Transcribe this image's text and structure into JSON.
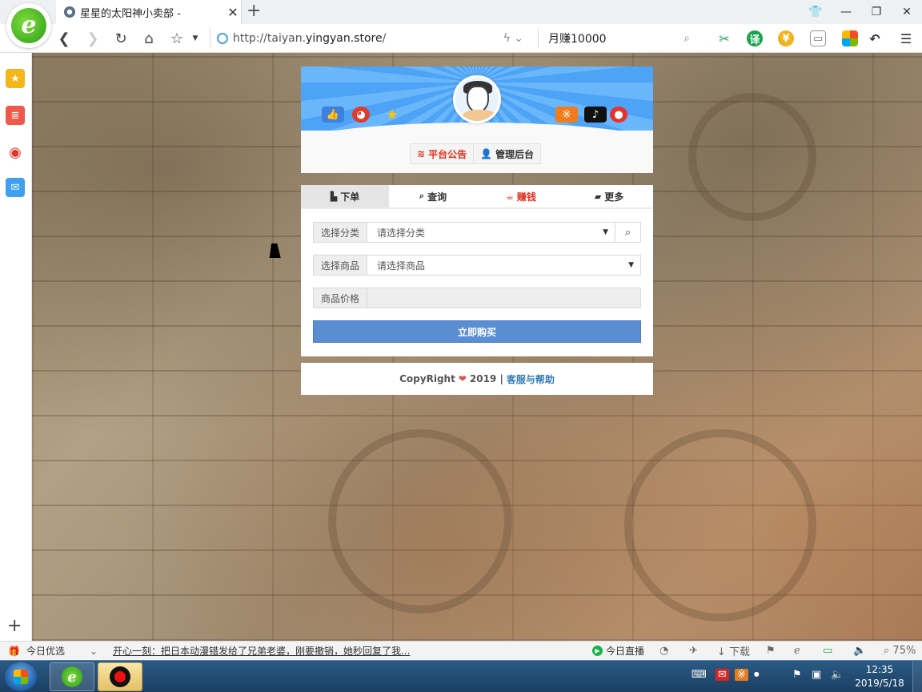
{
  "browser": {
    "tab_title": "星星的太阳神小卖部 -",
    "url_prefix": "http://taiyan.",
    "url_domain": "yingyan.store",
    "url_suffix": "/",
    "search_query": "月赚10000",
    "new_tab_symbol": "+",
    "tab_close_symbol": "✕"
  },
  "header": {
    "notice_button": "平台公告",
    "admin_button": "管理后台"
  },
  "tabs": [
    {
      "label": "下单",
      "icon": "shopping-bag-icon"
    },
    {
      "label": "查询",
      "icon": "search-icon"
    },
    {
      "label": "赚钱",
      "icon": "coffee-cup-icon"
    },
    {
      "label": "更多",
      "icon": "folder-open-icon"
    }
  ],
  "form": {
    "category_label": "选择分类",
    "category_placeholder": "请选择分类",
    "product_label": "选择商品",
    "product_placeholder": "请选择商品",
    "price_label": "商品价格",
    "price_value": "",
    "buy_button": "立即购买"
  },
  "footer": {
    "copyright": "CopyRight",
    "year_sep": "2019 |",
    "help_link": "客服与帮助"
  },
  "statusbar": {
    "featured": "今日优选",
    "headline": "开心一刻：把日本动漫错发给了兄弟老婆，刚要撤销，她秒回复了我...",
    "live": "今日直播",
    "download": "下载",
    "zoom": "75%"
  },
  "taskbar": {
    "time": "12:35",
    "date": "2019/5/18"
  },
  "colors": {
    "buy_button": "#5b8dd3",
    "earn_tab": "#e0301e",
    "help_link": "#337ab7"
  }
}
